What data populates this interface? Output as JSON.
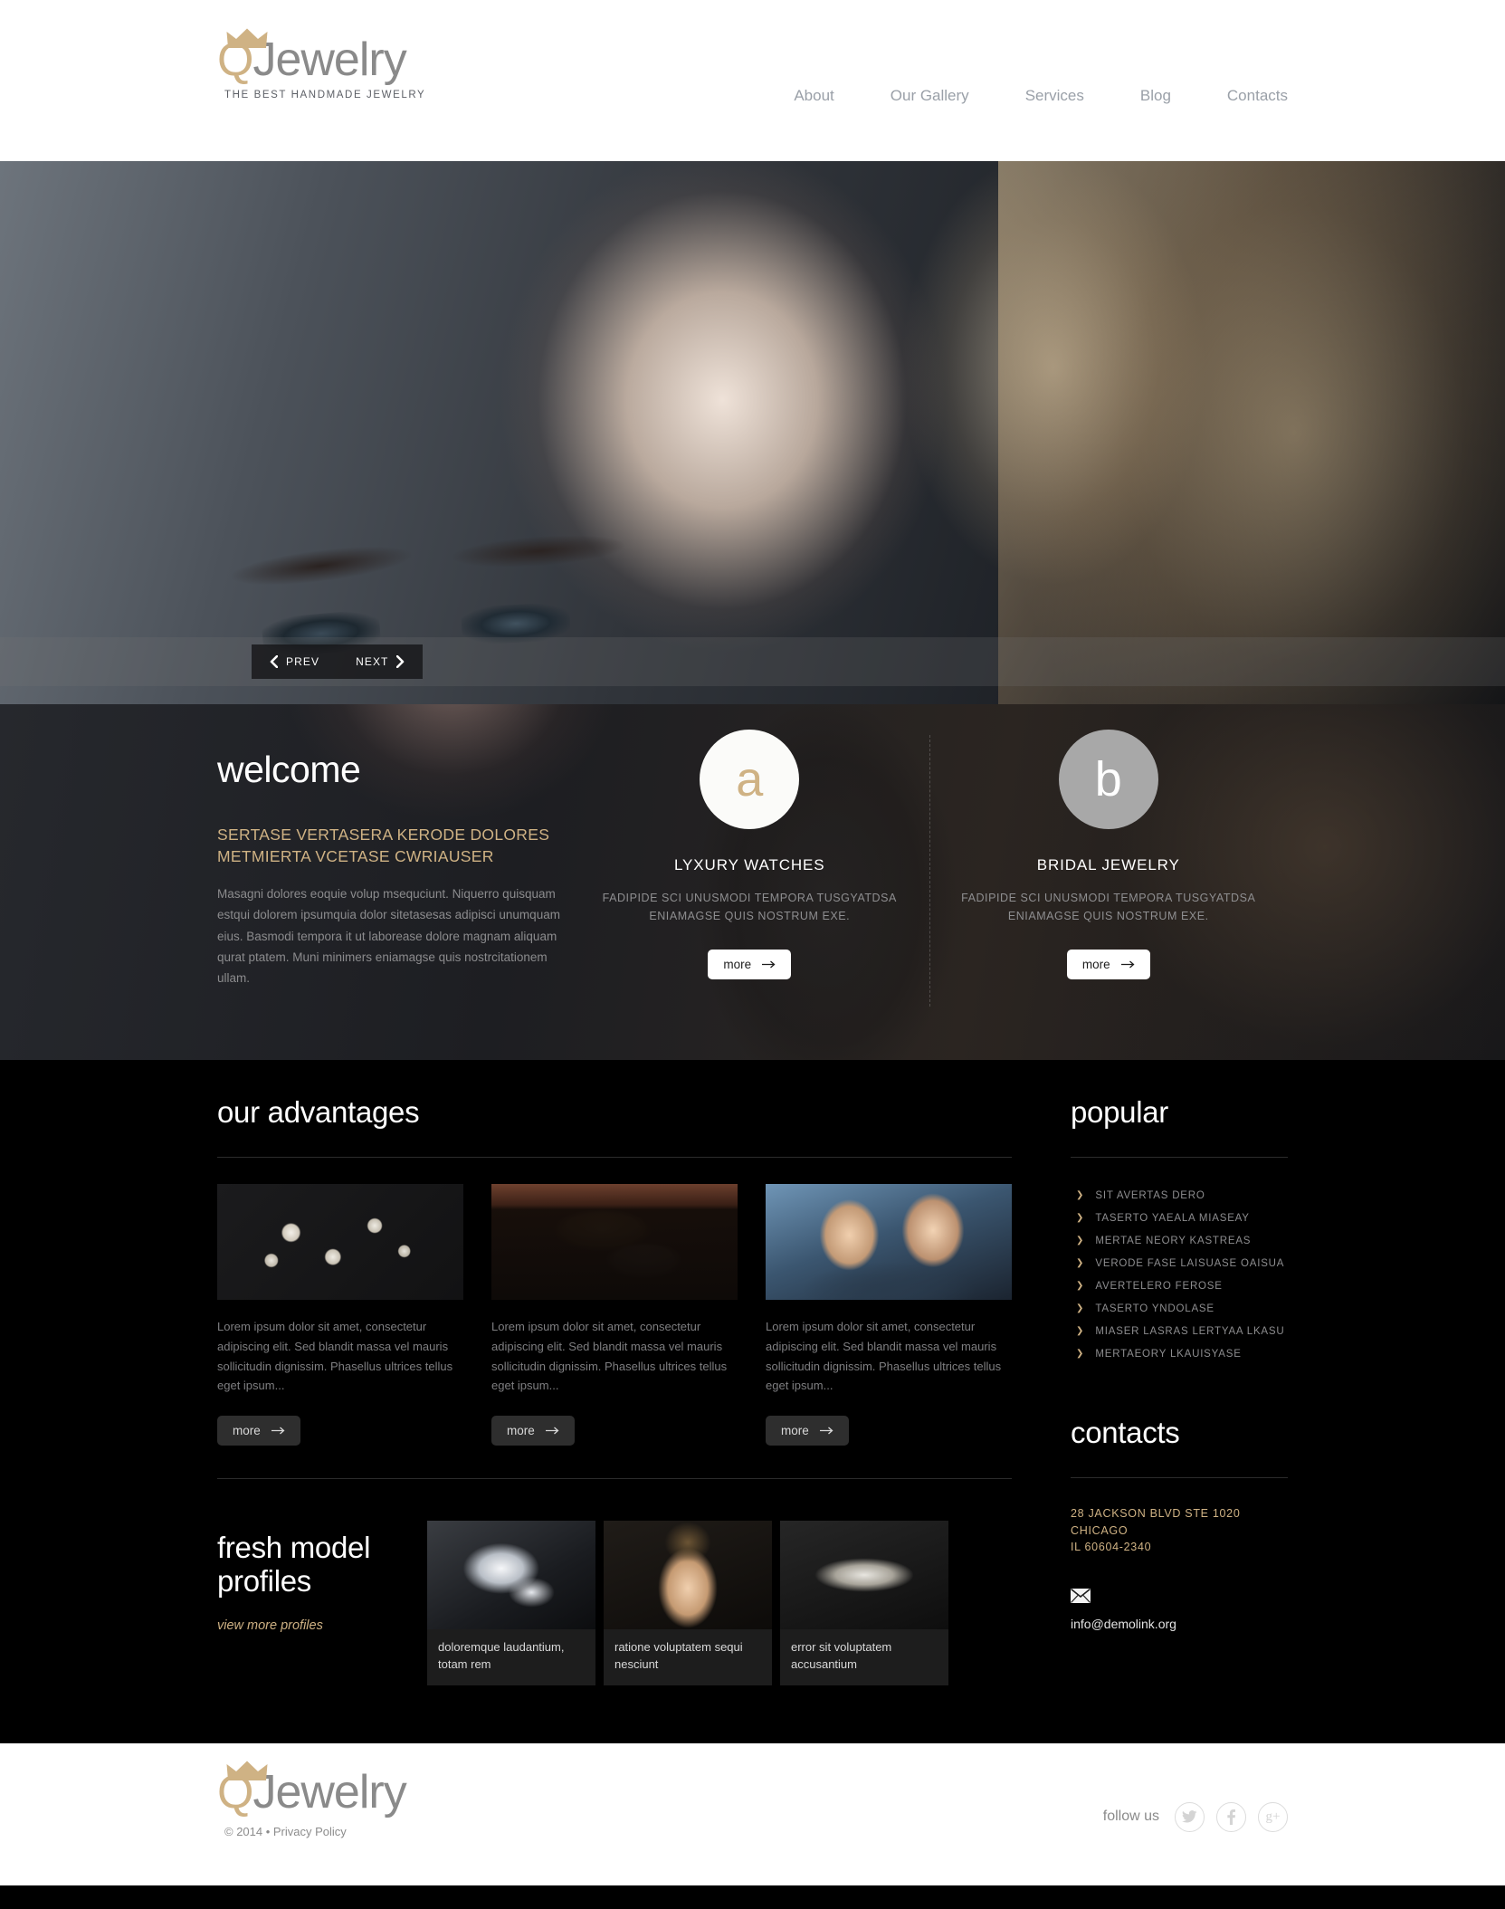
{
  "brand": {
    "logo_q": "Q",
    "logo_rest": "Jewelry",
    "tagline": "THE BEST HANDMADE JEWELRY",
    "accent_color": "#cfb284",
    "logo_gray": "#8a8a8a"
  },
  "nav": {
    "items": [
      {
        "label": "About"
      },
      {
        "label": "Our Gallery"
      },
      {
        "label": "Services"
      },
      {
        "label": "Blog"
      },
      {
        "label": "Contacts"
      }
    ]
  },
  "slider": {
    "prev_label": "PREV",
    "next_label": "NEXT"
  },
  "welcome": {
    "title": "welcome",
    "subtitle": "SERTASE VERTASERA KERODE DOLORES METMIERTA VCETASE CWRIAUSER",
    "body": "Masagni dolores eoquie volup msequciunt. Niquerro quisquam estqui dolorem ipsumquia dolor sitetasesas adipisci unumquam eius. Basmodi tempora it ut laborease dolore magnam aliquam qurat ptatem. Muni minimers eniamagse quis nostrcitationem ullam."
  },
  "services": [
    {
      "letter": "a",
      "title": "LYXURY WATCHES",
      "text": "FADIPIDE SCI UNUSMODI TEMPORA TUSGYATDSA ENIAMAGSE QUIS NOSTRUM EXE.",
      "button": "more",
      "circle_bg": "#fbfbf9",
      "circle_fg": "#cfb284"
    },
    {
      "letter": "b",
      "title": "BRIDAL JEWELRY",
      "text": "FADIPIDE SCI UNUSMODI TEMPORA TUSGYATDSA ENIAMAGSE QUIS NOSTRUM EXE.",
      "button": "more",
      "circle_bg": "#a8a8a8",
      "circle_fg": "#ffffff"
    }
  ],
  "advantages": {
    "title": "our advantages",
    "cards": [
      {
        "image_name": "pearl-necklace-photo",
        "text": "Lorem ipsum dolor sit amet, consectetur adipiscing elit. Sed blandit massa vel mauris sollicitudin dignissim. Phasellus ultrices tellus eget ipsum...",
        "button": "more"
      },
      {
        "image_name": "jewelry-box-photo",
        "text": "Lorem ipsum dolor sit amet, consectetur adipiscing elit. Sed blandit massa vel mauris sollicitudin dignissim. Phasellus ultrices tellus eget ipsum...",
        "button": "more"
      },
      {
        "image_name": "couple-gift-photo",
        "text": "Lorem ipsum dolor sit amet, consectetur adipiscing elit. Sed blandit massa vel mauris sollicitudin dignissim. Phasellus ultrices tellus eget ipsum...",
        "button": "more"
      }
    ]
  },
  "fresh": {
    "title_line1": "fresh model",
    "title_line2": "profiles",
    "link": "view more profiles",
    "profiles": [
      {
        "image_name": "diamond-ring-photo",
        "caption": "doloremque laudantium, totam rem"
      },
      {
        "image_name": "model-necklace-photo",
        "caption": "ratione voluptatem sequi nesciunt"
      },
      {
        "image_name": "tiara-photo",
        "caption": "error sit voluptatem accusantium"
      }
    ]
  },
  "popular": {
    "title": "popular",
    "items": [
      {
        "label": "SIT AVERTAS DERO"
      },
      {
        "label": "TASERTO YAEALA MIASEAY"
      },
      {
        "label": "MERTAE NEORY KASTREAS"
      },
      {
        "label": "VERODE FASE LAISUASE OAISUA"
      },
      {
        "label": "AVERTELERO FEROSE"
      },
      {
        "label": "TASERTO YNDOLASE"
      },
      {
        "label": "MIASER LASRAS LERTYAA LKASU"
      },
      {
        "label": "MERTAEORY LKAUISYASE"
      }
    ]
  },
  "contacts": {
    "title": "contacts",
    "address": "28 JACKSON BLVD STE 1020 CHICAGO IL 60604-2340",
    "address_line1": "28 JACKSON BLVD STE 1020",
    "address_line2": "CHICAGO",
    "address_line3": "IL 60604-2340",
    "email": "info@demolink.org"
  },
  "footer": {
    "copyright": "© 2014 • Privacy Policy",
    "follow_label": "follow us",
    "social": [
      {
        "name": "twitter-icon",
        "glyph": "t"
      },
      {
        "name": "facebook-icon",
        "glyph": "f"
      },
      {
        "name": "google-plus-icon",
        "glyph": "g+"
      }
    ]
  }
}
